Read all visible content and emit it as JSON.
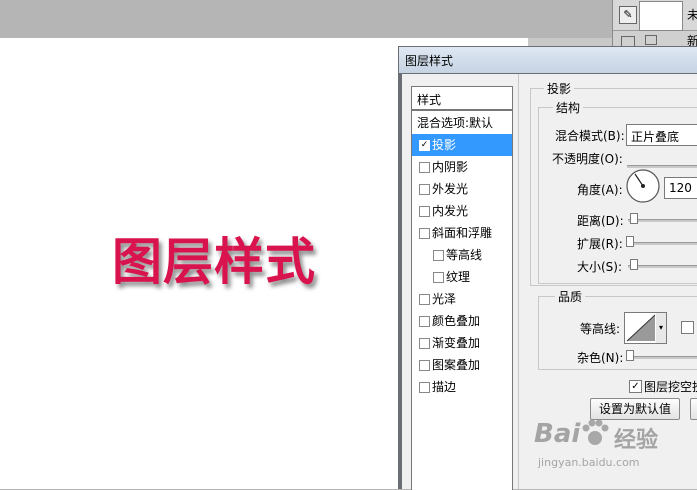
{
  "layers": {
    "layer1_name": "未标",
    "layer2_name": "新建"
  },
  "canvas": {
    "text": "图层样式",
    "text_color": "#d9134e"
  },
  "dialog": {
    "title": "图层样式",
    "list_header": "样式",
    "list_items": [
      {
        "label": "混合选项:默认"
      },
      {
        "label": "投影",
        "checked": true
      },
      {
        "label": "内阴影"
      },
      {
        "label": "外发光"
      },
      {
        "label": "内发光"
      },
      {
        "label": "斜面和浮雕"
      },
      {
        "label": "等高线"
      },
      {
        "label": "纹理"
      },
      {
        "label": "光泽"
      },
      {
        "label": "颜色叠加"
      },
      {
        "label": "渐变叠加"
      },
      {
        "label": "图案叠加"
      },
      {
        "label": "描边"
      }
    ],
    "section_title": "投影",
    "structure": {
      "title": "结构",
      "blend_mode_label": "混合模式(B):",
      "blend_mode_value": "正片叠底",
      "opacity_label": "不透明度(O):",
      "angle_label": "角度(A):",
      "angle_value": "120",
      "distance_label": "距离(D):",
      "spread_label": "扩展(R):",
      "size_label": "大小(S):"
    },
    "quality": {
      "title": "品质",
      "contour_label": "等高线:",
      "noise_label": "杂色(N):"
    },
    "knockout_label": "图层挖空投",
    "set_default_button": "设置为默认值"
  },
  "watermark": {
    "brand": "Bai",
    "brand_cn": "经验",
    "url": "jingyan.baidu.com"
  },
  "colors": {
    "selection": "#3399ff",
    "title_bar": "#c6d3e3"
  }
}
